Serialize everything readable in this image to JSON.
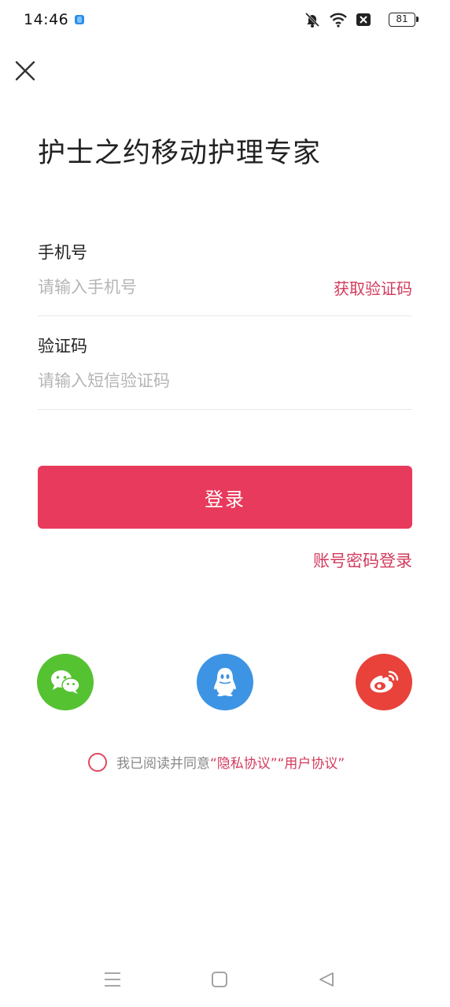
{
  "status_bar": {
    "time": "14:46",
    "battery": "81",
    "icons": [
      "app-icon",
      "mute-icon",
      "wifi-icon",
      "close-box-icon",
      "battery-icon"
    ]
  },
  "header": {
    "close_icon": "close-icon",
    "title": "护士之约移动护理专家"
  },
  "form": {
    "phone": {
      "label": "手机号",
      "placeholder": "请输入手机号",
      "value": "",
      "get_code_label": "获取验证码"
    },
    "code": {
      "label": "验证码",
      "placeholder": "请输入短信验证码",
      "value": ""
    },
    "login_label": "登录",
    "password_login_label": "账号密码登录"
  },
  "social": [
    {
      "name": "wechat",
      "icon": "wechat-icon",
      "color": "#55c232"
    },
    {
      "name": "qq",
      "icon": "qq-icon",
      "color": "#3d94e4"
    },
    {
      "name": "weibo",
      "icon": "weibo-icon",
      "color": "#e8423a"
    }
  ],
  "agreement": {
    "checked": false,
    "prefix": "我已阅读并同意",
    "privacy": "“隐私协议”",
    "user": "“用户协议”"
  },
  "nav_bar": {
    "icons": [
      "menu-icon",
      "home-icon",
      "back-icon"
    ]
  },
  "colors": {
    "accent": "#e83a5c",
    "link": "#d23b5c",
    "placeholder": "#b5b5b5",
    "divider": "#e8e8e8"
  }
}
